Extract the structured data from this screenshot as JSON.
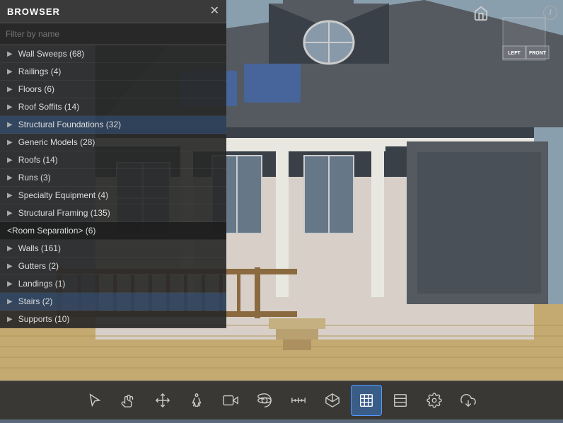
{
  "browser": {
    "title": "BROWSER",
    "close_label": "✕",
    "search_placeholder": "Filter by name",
    "items": [
      {
        "label": "Wall Sweeps (68)",
        "indent": false,
        "has_arrow": true
      },
      {
        "label": "Railings (4)",
        "indent": false,
        "has_arrow": true
      },
      {
        "label": "Floors (6)",
        "indent": false,
        "has_arrow": true
      },
      {
        "label": "Roof Soffits (14)",
        "indent": false,
        "has_arrow": true
      },
      {
        "label": "Structural Foundations (32)",
        "indent": false,
        "has_arrow": true,
        "selected": true
      },
      {
        "label": "Generic Models (28)",
        "indent": false,
        "has_arrow": true
      },
      {
        "label": "Roofs (14)",
        "indent": false,
        "has_arrow": true
      },
      {
        "label": "Runs (3)",
        "indent": false,
        "has_arrow": true
      },
      {
        "label": "Specialty Equipment (4)",
        "indent": false,
        "has_arrow": true
      },
      {
        "label": "Structural Framing (135)",
        "indent": false,
        "has_arrow": true
      }
    ],
    "room_sep": "<Room Separation> (6)",
    "items2": [
      {
        "label": "Walls (161)",
        "has_arrow": true
      },
      {
        "label": "Gutters (2)",
        "has_arrow": true
      },
      {
        "label": "Landings (1)",
        "has_arrow": true
      },
      {
        "label": "Stairs (2)",
        "has_arrow": true,
        "selected": true
      },
      {
        "label": "Supports (10)",
        "has_arrow": true
      }
    ]
  },
  "nav": {
    "left_label": "LEFT",
    "front_label": "FRONT",
    "home_icon": "⌂",
    "info_icon": "i"
  },
  "toolbar": {
    "tools": [
      {
        "name": "select-tool",
        "icon": "✛",
        "active": false
      },
      {
        "name": "pan-tool",
        "icon": "✋",
        "active": false
      },
      {
        "name": "move-tool",
        "icon": "⬍",
        "active": false
      },
      {
        "name": "walk-tool",
        "icon": "🚶",
        "active": false
      },
      {
        "name": "camera-tool",
        "icon": "🎥",
        "active": false
      },
      {
        "name": "orbit-tool",
        "icon": "◈",
        "active": false
      },
      {
        "name": "measure-tool",
        "icon": "📏",
        "active": false
      },
      {
        "name": "box-tool",
        "icon": "⬡",
        "active": false
      },
      {
        "name": "section-box-tool",
        "icon": "⊞",
        "active": true
      },
      {
        "name": "plan-tool",
        "icon": "▤",
        "active": false
      },
      {
        "name": "settings-tool",
        "icon": "⚙",
        "active": false
      },
      {
        "name": "export-tool",
        "icon": "⬡",
        "active": false
      }
    ]
  }
}
